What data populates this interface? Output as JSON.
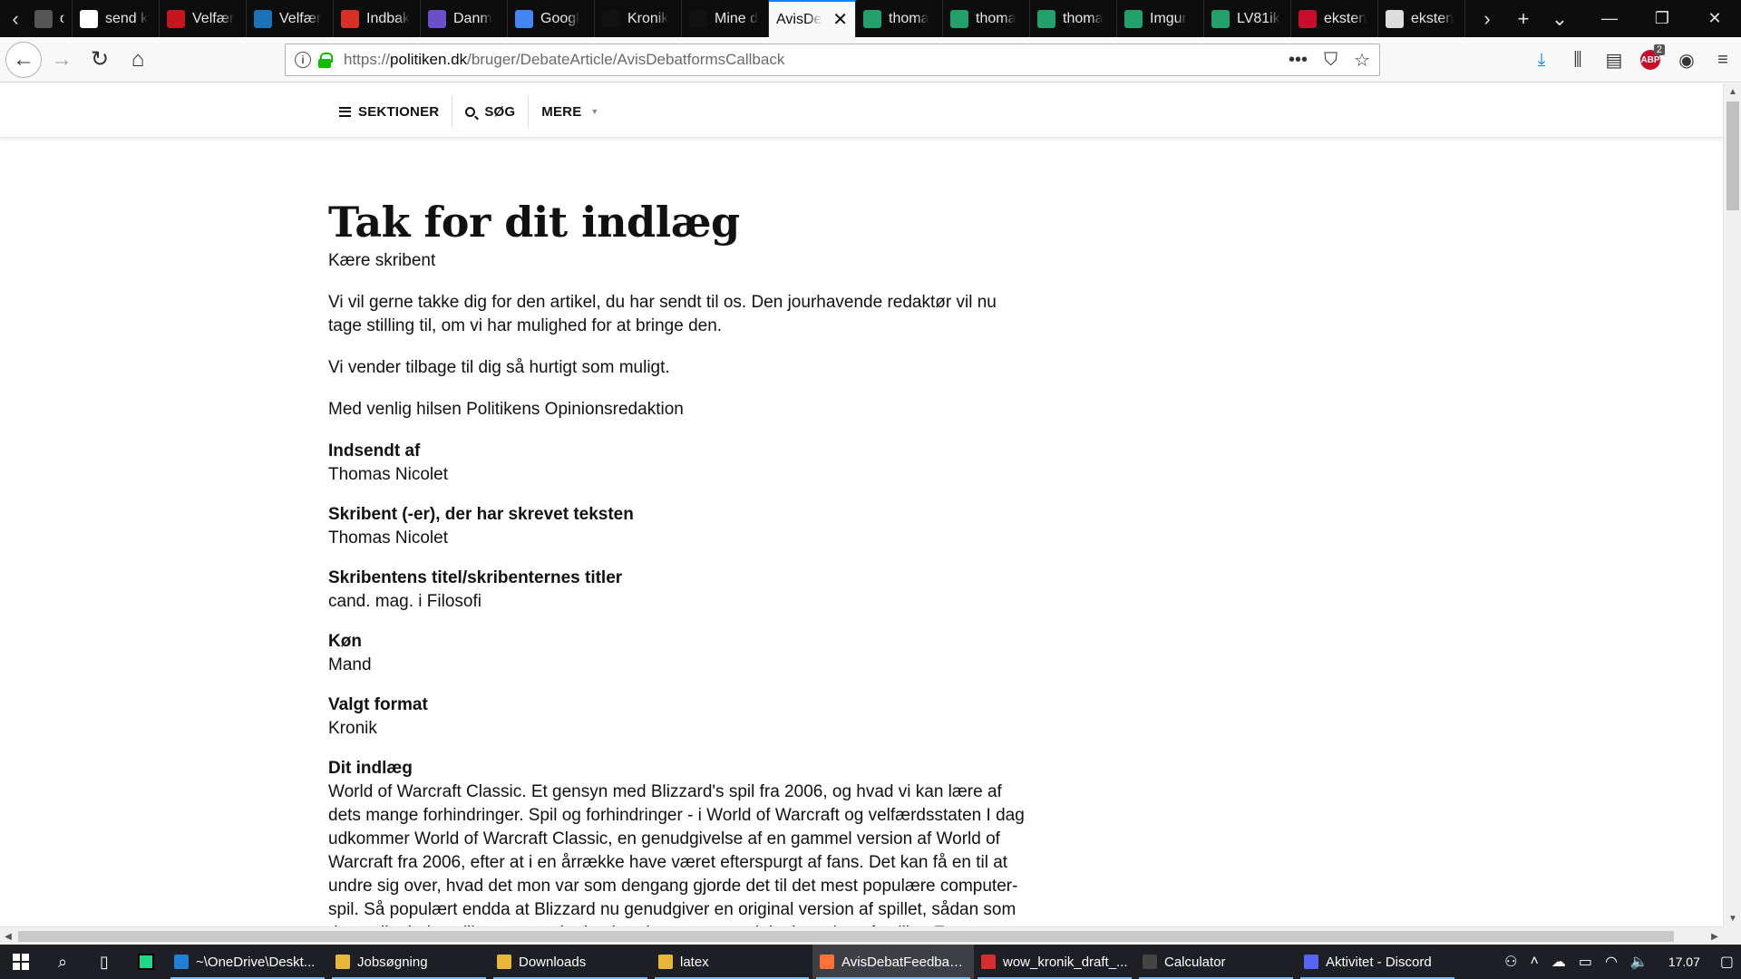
{
  "browser": {
    "tabs": [
      {
        "label": "oyc",
        "icon": "generic-tab-icon",
        "color": "#555555"
      },
      {
        "label": "send k",
        "icon": "google-icon",
        "color": "#ffffff"
      },
      {
        "label": "Velfær",
        "icon": "v-logo-icon",
        "color": "#c4161c"
      },
      {
        "label": "Velfær",
        "icon": "h-logo-icon",
        "color": "#1a73b8"
      },
      {
        "label": "Indbak",
        "icon": "gmail-icon",
        "color": "#d93025"
      },
      {
        "label": "Danm",
        "icon": "moon-icon",
        "color": "#6a4fc8"
      },
      {
        "label": "Googl",
        "icon": "google-docs-icon",
        "color": "#4285f4"
      },
      {
        "label": "Kronik",
        "icon": "p-logo-icon",
        "color": "#111111"
      },
      {
        "label": "Mine d",
        "icon": "p-logo-icon",
        "color": "#111111"
      },
      {
        "label": "AvisDe",
        "icon": "",
        "color": "",
        "active": true
      },
      {
        "label": "thoma",
        "icon": "reply-icon",
        "color": "#22a06b"
      },
      {
        "label": "thoma",
        "icon": "reply-icon",
        "color": "#22a06b"
      },
      {
        "label": "thoma",
        "icon": "reply-icon",
        "color": "#22a06b"
      },
      {
        "label": "Imgur",
        "icon": "reply-icon",
        "color": "#22a06b"
      },
      {
        "label": "LV81ik",
        "icon": "reply-icon",
        "color": "#22a06b"
      },
      {
        "label": "eksten",
        "icon": "shield-icon",
        "color": "#c70d2c"
      },
      {
        "label": "eksten",
        "icon": "document-icon",
        "color": "#dddddd"
      }
    ],
    "url": {
      "scheme": "https://",
      "host": "politiken.dk",
      "path": "/bruger/DebateArticle/AvisDebatformsCallback"
    },
    "adblock_badge": "2"
  },
  "site": {
    "nav": {
      "sections": "SEKTIONER",
      "search": "SØG",
      "more": "MERE"
    }
  },
  "article": {
    "title": "Tak for dit indlæg",
    "greeting": "Kære skribent",
    "paragraphs": [
      "Vi vil gerne takke dig for den artikel, du har sendt til os. Den jourhavende redaktør vil nu tage stilling til, om vi har mulighed for at bringe den.",
      "Vi vender tilbage til dig så hurtigt som muligt.",
      "Med venlig hilsen Politikens Opinionsredaktion"
    ],
    "fields": [
      {
        "label": "Indsendt af",
        "value": "Thomas Nicolet"
      },
      {
        "label": "Skribent (-er), der har skrevet teksten",
        "value": "Thomas Nicolet"
      },
      {
        "label": "Skribentens titel/skribenternes titler",
        "value": "cand. mag. i Filosofi"
      },
      {
        "label": "Køn",
        "value": "Mand"
      },
      {
        "label": "Valgt format",
        "value": "Kronik"
      }
    ],
    "body_label": "Dit indlæg",
    "body_text": "World of Warcraft Classic. Et gensyn med Blizzard's spil fra 2006, og hvad vi kan lære af dets mange forhindringer. Spil og forhindringer - i World of Warcraft og velfærdsstaten I dag udkommer World of Warcraft Classic, en genudgivelse af en gammel version af World of Warcraft fra 2006, efter at i en årrække have været efterspurgt af fans. Det kan få en til at undre sig over, hvad det mon var som dengang gjorde det til det mest populære computer-spil. Så populært endda at Blizzard nu genudgiver en original version af spillet, sådan som de studieglade spillere og nørder husker den, som en original version af spillet. E"
  },
  "taskbar": {
    "apps": [
      {
        "label": "~\\OneDrive\\Deskt...",
        "icon": "vscode-icon",
        "color": "#1f7fd6"
      },
      {
        "label": "Jobsøgning",
        "icon": "folder-icon",
        "color": "#e8b739"
      },
      {
        "label": "Downloads",
        "icon": "folder-icon",
        "color": "#e8b739"
      },
      {
        "label": "latex",
        "icon": "folder-icon",
        "color": "#e8b739"
      },
      {
        "label": "AvisDebatFeedbac...",
        "icon": "firefox-icon",
        "color": "#ff7139",
        "active": true
      },
      {
        "label": "wow_kronik_draft_...",
        "icon": "pdf-icon",
        "color": "#d32f2f"
      },
      {
        "label": "Calculator",
        "icon": "calculator-icon",
        "color": "#444444"
      },
      {
        "label": "Aktivitet - Discord",
        "icon": "discord-icon",
        "color": "#5865f2"
      }
    ],
    "clock": "17.07"
  }
}
